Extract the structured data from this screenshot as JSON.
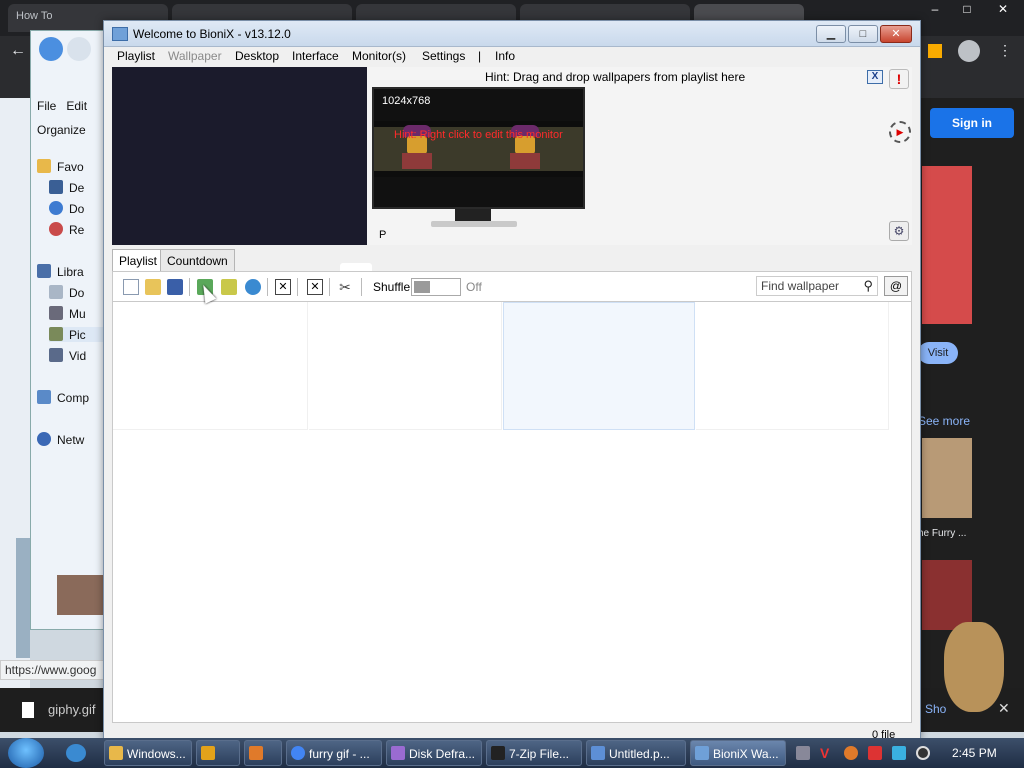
{
  "background": {
    "browser_tab_title": "How To",
    "explorer_items": [
      {
        "label": "File",
        "icon": "menu"
      },
      {
        "label": "Edit",
        "icon": "menu"
      },
      {
        "label": "Organize",
        "icon": "menu"
      },
      {
        "label": "Favo",
        "icon": "star-icon"
      },
      {
        "label": "De",
        "icon": "desktop-icon"
      },
      {
        "label": "Do",
        "icon": "download-icon"
      },
      {
        "label": "Re",
        "icon": "recent-icon"
      },
      {
        "label": "Libra",
        "icon": "library-icon"
      },
      {
        "label": "Do",
        "icon": "documents-icon"
      },
      {
        "label": "Mu",
        "icon": "music-icon"
      },
      {
        "label": "Pic",
        "icon": "pictures-icon"
      },
      {
        "label": "Vid",
        "icon": "videos-icon"
      },
      {
        "label": "Comp",
        "icon": "computer-icon"
      },
      {
        "label": "Netw",
        "icon": "network-icon"
      }
    ],
    "status_url": "https://www.goog",
    "download_file": "giphy.gif",
    "sign_in_label": "Sign in",
    "visit_label": "Visit",
    "see_more_label": "See more",
    "the_furry_caption": "he Furry ...",
    "show_label": "Sho"
  },
  "window": {
    "title": "Welcome to BioniX -  v13.12.0",
    "menu": [
      "Playlist",
      "Wallpaper",
      "Desktop",
      "Interface",
      "Monitor(s)",
      "Settings",
      "|",
      "Info"
    ],
    "hint": "Hint: Drag and drop wallpapers from playlist here",
    "hint_close": "X",
    "monitor": {
      "resolution": "1024x768",
      "edit_hint": "Hint: Right click to edit this monitor",
      "label": "P"
    },
    "tabs": [
      "Playlist",
      "Countdown"
    ],
    "toolbar": {
      "shuffle_label": "Shuffle",
      "shuffle_state": "Off",
      "find_placeholder": "Find wallpaper",
      "at_button": "@"
    },
    "file_count": "0 file"
  },
  "taskbar": {
    "items": [
      {
        "label": "Windows...",
        "icon_color": "#e8b84a"
      },
      {
        "label": "",
        "icon_color": "#e3a21a"
      },
      {
        "label": "",
        "icon_color": "#e07a2a"
      },
      {
        "label": "furry gif - ...",
        "icon_color": "#4285f4"
      },
      {
        "label": "Disk Defra...",
        "icon_color": "#9a6bd1"
      },
      {
        "label": "7-Zip File...",
        "icon_color": "#222222"
      },
      {
        "label": "Untitled.p...",
        "icon_color": "#5d8fd6"
      },
      {
        "label": "BioniX Wa...",
        "icon_color": "#6fa0d8"
      }
    ],
    "clock": "2:45 PM"
  },
  "colors": {
    "window_title_bg": "#c9d9ec",
    "hint_text": "#ff2b2b",
    "accent": "#1a73e8"
  }
}
